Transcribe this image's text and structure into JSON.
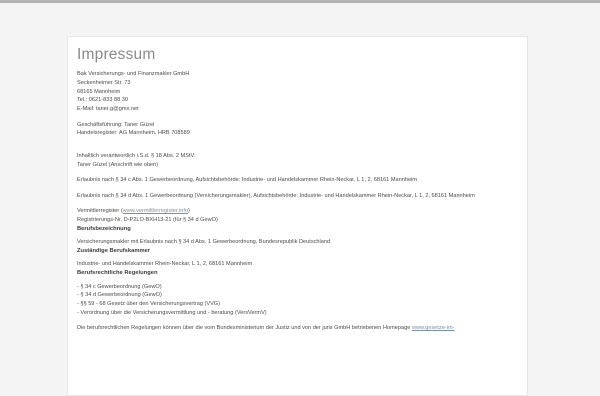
{
  "page_title": "Impressum",
  "company": {
    "name": "Bak Versicherungs- und Finanzmakler GmbH",
    "street": "Seckenheimer Str. 73",
    "city": "68165 Mannheim",
    "phone": "Tel.: 0621-833 88 30",
    "email": "E-Mail: taner.g@gmx.net"
  },
  "management": {
    "director": "Geschäftsführung: Taner Güzel",
    "register": "Handelsregister: AG Mannheim, HRB 708589"
  },
  "responsible": {
    "line1": "Inhaltlich verantwortlich i.S.d. § 18 Abs. 2 MStV:",
    "line2": "Taner Güzel (Anschrift wie oben)"
  },
  "permits": {
    "permit_34c": "Erlaubnis nach § 34 c Abs. 1 Gewerbeordnung, Aufsichtsbehörde: Industrie- und Handelskammer Rhein-Neckar, L 1, 2, 68161 Mannheim",
    "permit_34d": "Erlaubnis nach § 34 d Abs. 1 Gewerbeordnung (Versicherungsmakler), Aufsichtsbehörde: Industrie- und Handelskammer Rhein-Neckar, L 1, 2, 68161 Mannheim"
  },
  "registry": {
    "prefix": "Vermittlerregister (",
    "link": "www.vermittlerregister.info",
    "suffix": ")",
    "number": "Registrierungs-Nr. D-P2LO-BXH13-21 (für § 34 d GewO)"
  },
  "job_title": {
    "heading": "Berufsbezeichnung",
    "text": "Versicherungsmakler mit Erlaubnis nach § 34 d Abs. 1 Gewerbeordnung, Bundesrepublik Deutschland"
  },
  "chamber": {
    "heading": "Zuständige Berufskammer",
    "text": "Industrie- und Handelskammer Rhein-Neckar, L 1, 2, 68161 Mannheim"
  },
  "regulations": {
    "heading": "Berufsrechtliche Regelungen",
    "items": [
      "- § 34 c Gewerbeordnung (GewO)",
      "- § 34 d Gewerbeordnung (GewO)",
      "- §§ 59 - 68 Gesetz über den Versicherungsvertrag (VVG)",
      "- Verordnung über die Versicherungsvermittlung und - beratung (VersVermV)"
    ],
    "footer_text": "Die berufsrechtlichen Regelungen können über die vom Bundesministerium der Justiz und von der juris GmbH betriebenen Homepage ",
    "footer_link": "www.gesetze-im-"
  }
}
